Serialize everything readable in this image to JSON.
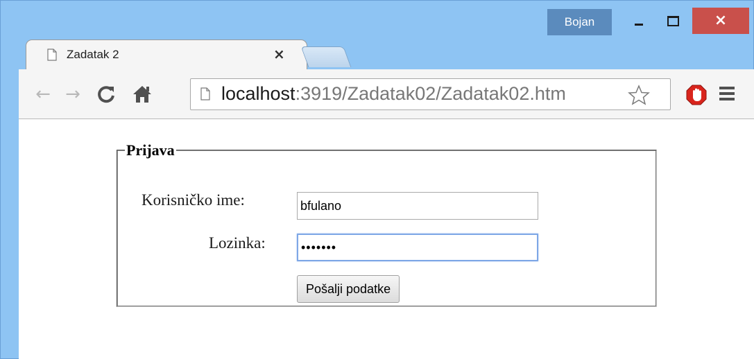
{
  "window": {
    "profile_name": "Bojan",
    "controls": {
      "minimize": "minimize",
      "maximize": "maximize",
      "close": "×"
    }
  },
  "tabs": [
    {
      "title": "Zadatak 2",
      "close": "×",
      "active": true
    }
  ],
  "toolbar": {
    "back_icon": "←",
    "forward_icon": "→",
    "reload_icon": "C",
    "home_icon": "⌂",
    "url_host": "localhost",
    "url_rest": ":3919/Zadatak02/Zadatak02.htm"
  },
  "form": {
    "legend": "Prijava",
    "username_label": "Korisničko ime:",
    "username_value": "bfulano",
    "password_label": "Lozinka:",
    "password_value": "•••••••",
    "submit_label": "Pošalji podatke"
  },
  "colors": {
    "frame": "#8ec4f3",
    "close_button": "#c9504b",
    "profile_badge": "#5b8bbd",
    "stop_icon": "#d9241c"
  }
}
